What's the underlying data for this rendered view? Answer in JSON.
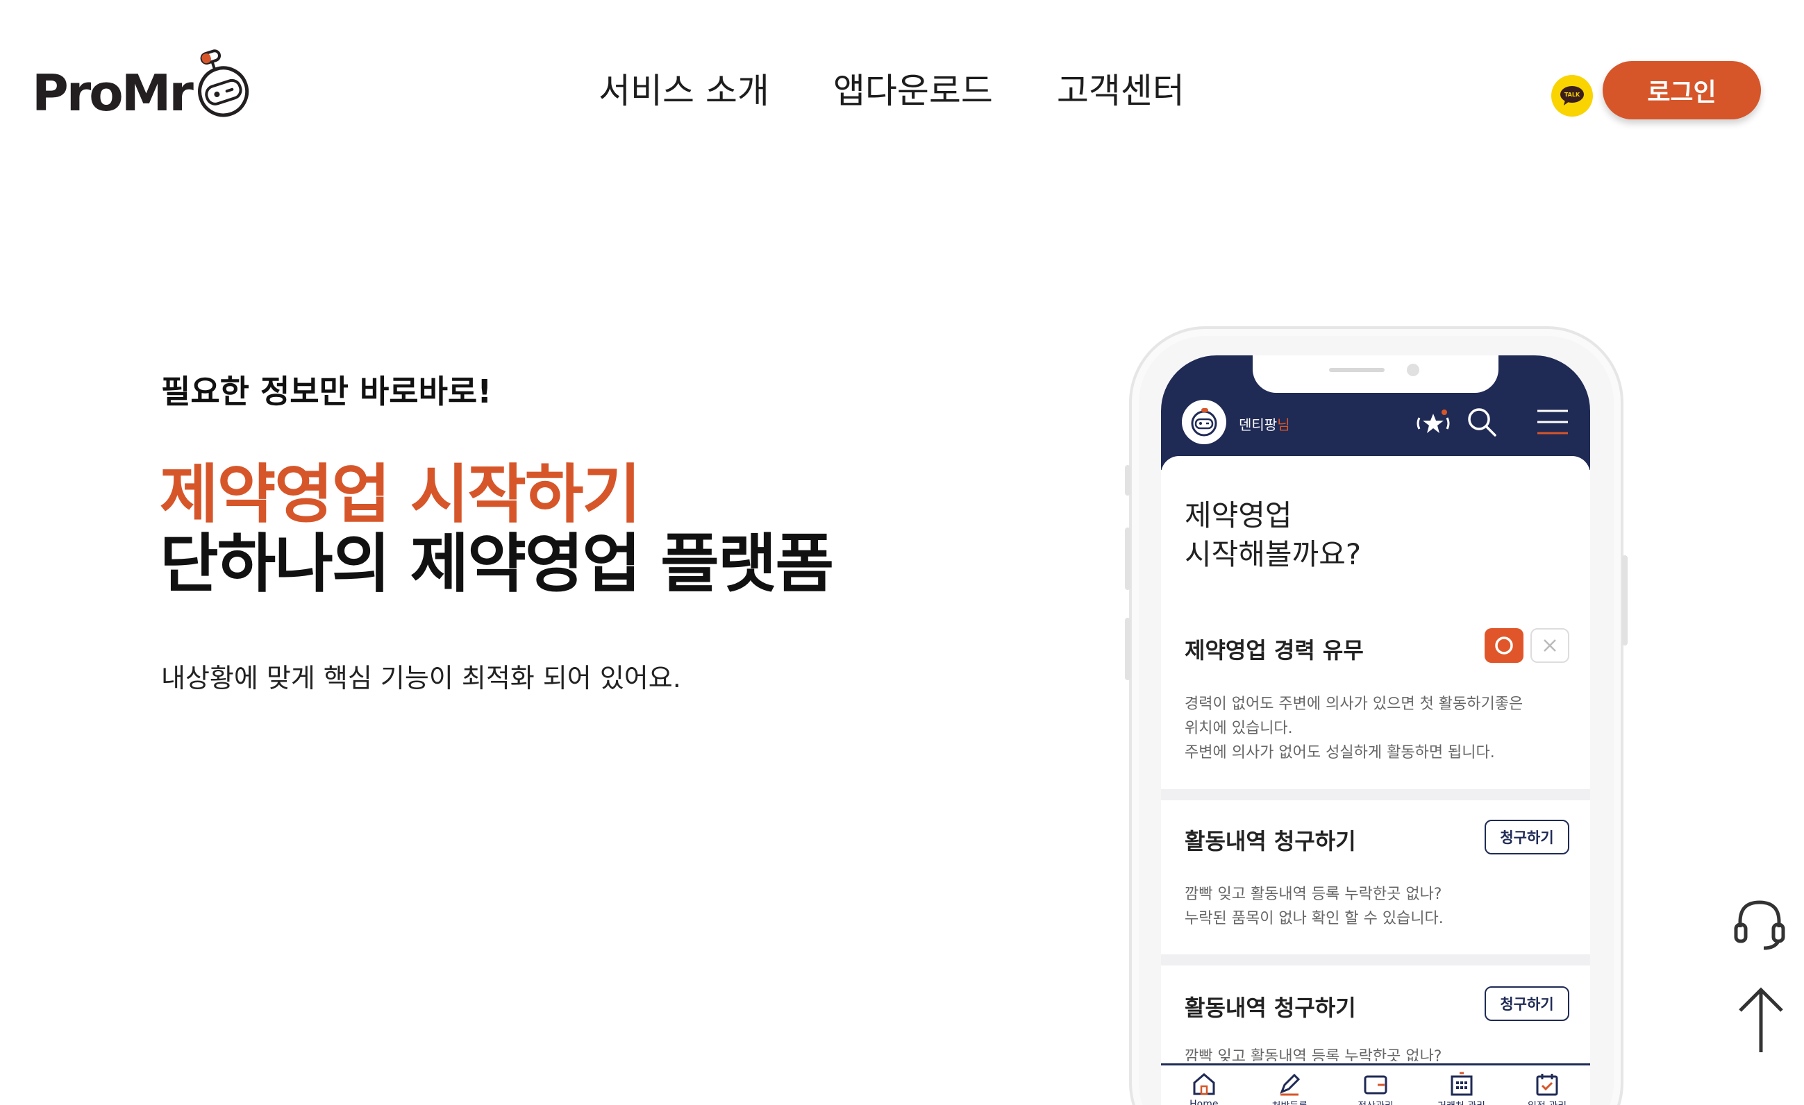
{
  "header": {
    "logo_text": "ProMr",
    "nav": [
      "서비스 소개",
      "앱다운로드",
      "고객센터"
    ],
    "kakao_label": "TALK",
    "login_label": "로그인"
  },
  "hero": {
    "tagline": "필요한 정보만 바로바로!",
    "headline_accent": "제약영업 시작하기",
    "headline": "단하나의 제약영업 플랫폼",
    "description": "내상황에 맞게 핵심 기능이 최적화 되어 있어요."
  },
  "app": {
    "user_name": "덴티팡",
    "user_suffix": "님",
    "title_highlight": "제약영업",
    "title_rest": "시작해볼까요?",
    "cards": [
      {
        "title": "제약영업 경력 유무",
        "lines": [
          "경력이 없어도 주변에 의사가 있으면 첫 활동하기좋은",
          "위치에 있습니다.",
          "주변에 의사가 없어도 성실하게 활동하면 됩니다."
        ]
      },
      {
        "title": "활동내역 청구하기",
        "button": "청구하기",
        "lines": [
          "깜빡 잊고 활동내역 등록 누락한곳 없나?",
          "누락된 품목이 없나 확인 할 수 있습니다."
        ]
      },
      {
        "title": "활동내역 청구하기",
        "button": "청구하기",
        "lines": [
          "깜빡 잊고 활동내역 등록 누락한곳 없나?"
        ]
      }
    ],
    "bottom_nav": [
      "Home",
      "처방등록",
      "정산관리",
      "거래처 관리",
      "일정 관리"
    ]
  },
  "colors": {
    "accent": "#d6562a",
    "navy": "#1f2a55",
    "kakao": "#f9d400"
  },
  "icons": [
    "kakao-talk-icon",
    "favorite-star-icon",
    "search-icon",
    "menu-icon",
    "home-icon",
    "prescription-icon",
    "wallet-icon",
    "building-icon",
    "calendar-icon",
    "headset-icon",
    "arrow-up-icon"
  ]
}
